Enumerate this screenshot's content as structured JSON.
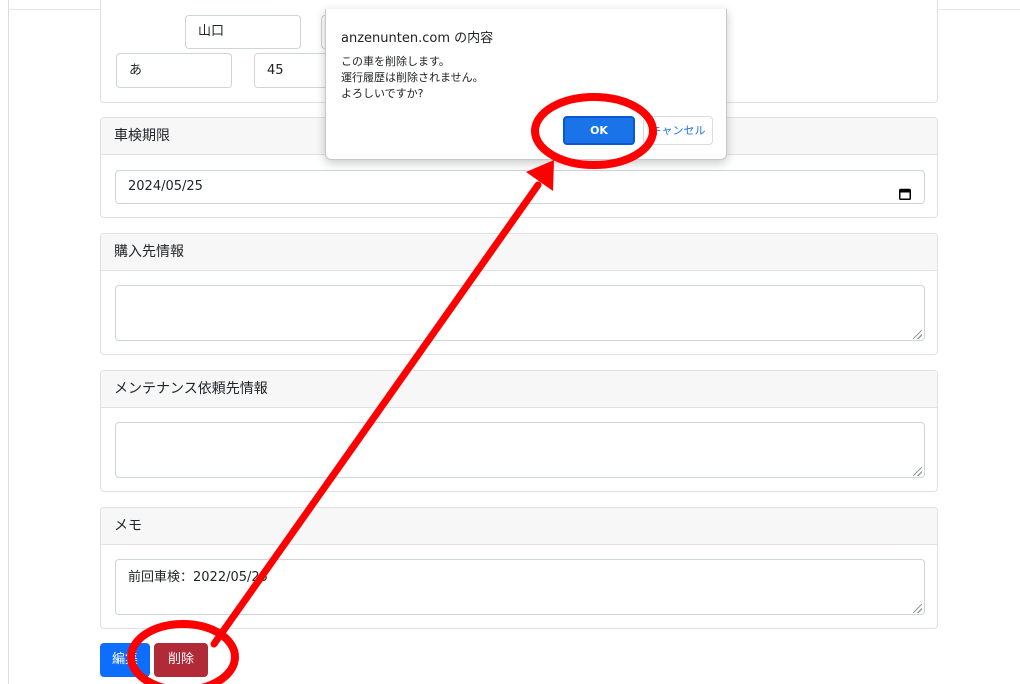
{
  "form": {
    "prefecture_value": "山口",
    "kana_value": "あ",
    "number_value": "45",
    "inspection": {
      "label": "車検期限",
      "value": "2024/05/25"
    },
    "supplier": {
      "label": "購入先情報",
      "value": ""
    },
    "maintenance": {
      "label": "メンテナンス依頼先情報",
      "value": ""
    },
    "memo": {
      "label": "メモ",
      "value": "前回車検：2022/05/25"
    }
  },
  "actions": {
    "edit_label": "編集",
    "delete_label": "削除"
  },
  "dialog": {
    "title": "anzenunten.com の内容",
    "line1": "この車を削除します。",
    "line2": "運行履歴は削除されません。",
    "line3": "よろしいですか?",
    "ok_label": "OK",
    "cancel_label": "キャンセル"
  },
  "annotation": {
    "color": "#ff0000"
  },
  "icons": {
    "calendar": "calendar-icon",
    "resize": "resize-handle-icon"
  }
}
